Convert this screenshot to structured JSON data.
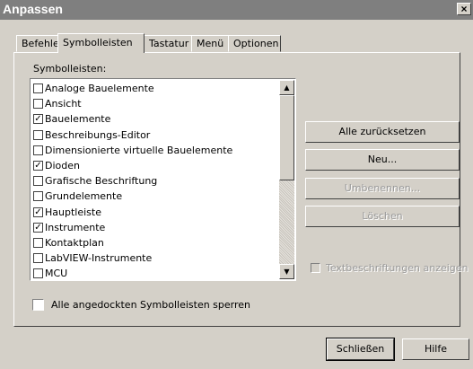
{
  "window": {
    "title": "Anpassen",
    "close_glyph": "×"
  },
  "tabs": [
    {
      "label": "Befehle",
      "active": false
    },
    {
      "label": "Symbolleisten",
      "active": true
    },
    {
      "label": "Tastatur",
      "active": false
    },
    {
      "label": "Menü",
      "active": false
    },
    {
      "label": "Optionen",
      "active": false
    }
  ],
  "toolbars": {
    "label": "Symbolleisten:",
    "items": [
      {
        "label": "Analoge Bauelemente",
        "checked": false
      },
      {
        "label": "Ansicht",
        "checked": false
      },
      {
        "label": "Bauelemente",
        "checked": true
      },
      {
        "label": "Beschreibungs-Editor",
        "checked": false
      },
      {
        "label": "Dimensionierte virtuelle Bauelemente",
        "checked": false
      },
      {
        "label": "Dioden",
        "checked": true
      },
      {
        "label": "Grafische Beschriftung",
        "checked": false
      },
      {
        "label": "Grundelemente",
        "checked": false
      },
      {
        "label": "Hauptleiste",
        "checked": true
      },
      {
        "label": "Instrumente",
        "checked": true
      },
      {
        "label": "Kontaktplan",
        "checked": false
      },
      {
        "label": "LabVIEW-Instrumente",
        "checked": false
      },
      {
        "label": "MCU",
        "checked": false
      }
    ],
    "scroll_up_icon": "▲",
    "scroll_down_icon": "▼"
  },
  "actions": {
    "reset_all": "Alle zurücksetzen",
    "new": "Neu...",
    "rename": "Umbenennen...",
    "delete": "Löschen"
  },
  "show_text_labels": {
    "label": "Textbeschriftungen anzeigen",
    "checked": false,
    "enabled": false
  },
  "lock_docked": {
    "label": "Alle angedockten Symbolleisten sperren",
    "checked": false
  },
  "footer": {
    "close": "Schließen",
    "help": "Hilfe"
  }
}
